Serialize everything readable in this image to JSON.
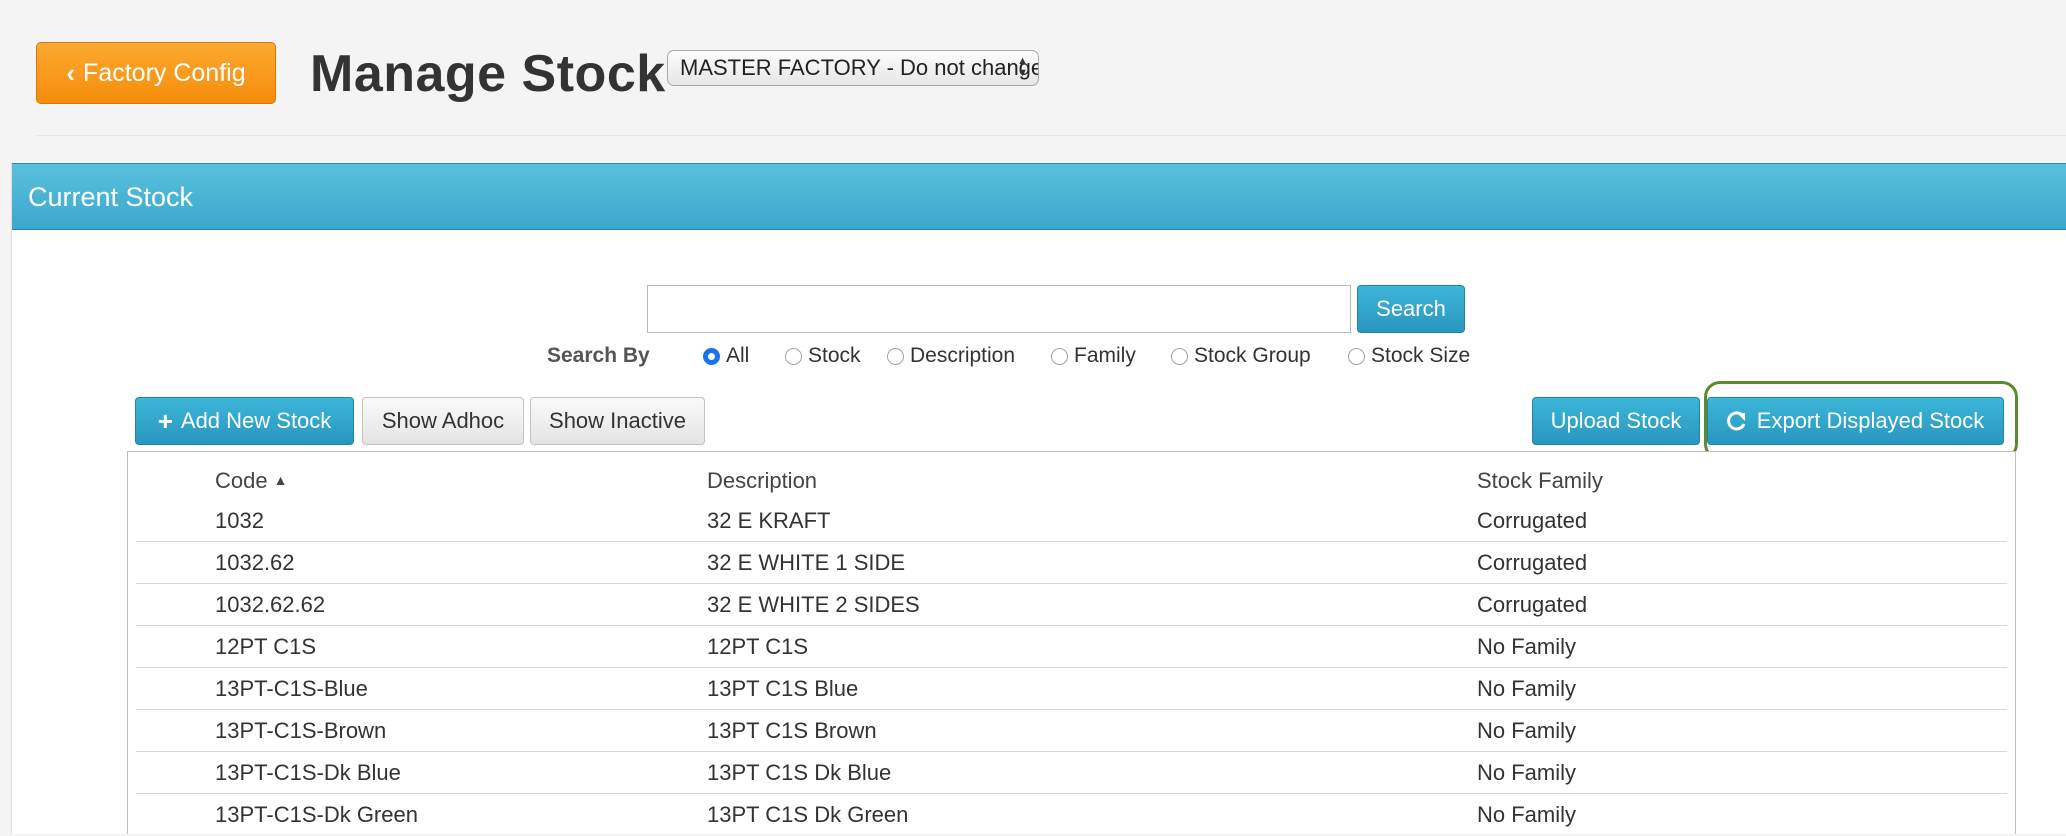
{
  "header": {
    "back_button_label": "Factory Config",
    "title": "Manage Stock",
    "factory_select_value": "MASTER FACTORY - Do not change"
  },
  "panel": {
    "title": "Current Stock"
  },
  "search": {
    "input_value": "",
    "button_label": "Search",
    "search_by_label": "Search By",
    "options": [
      "All",
      "Stock",
      "Description",
      "Family",
      "Stock Group",
      "Stock Size"
    ],
    "selected": "All"
  },
  "toolbar": {
    "add_new_label": "Add New Stock",
    "show_adhoc_label": "Show Adhoc",
    "show_inactive_label": "Show Inactive",
    "upload_label": "Upload Stock",
    "export_label": "Export Displayed Stock"
  },
  "table": {
    "columns": [
      "Code",
      "Description",
      "Stock Family"
    ],
    "sorted_by": "Code",
    "rows": [
      [
        "1032",
        "32 E KRAFT",
        "Corrugated"
      ],
      [
        "1032.62",
        "32 E WHITE 1 SIDE",
        "Corrugated"
      ],
      [
        "1032.62.62",
        "32 E WHITE 2 SIDES",
        "Corrugated"
      ],
      [
        "12PT C1S",
        "12PT C1S",
        "No Family"
      ],
      [
        "13PT-C1S-Blue",
        "13PT C1S Blue",
        "No Family"
      ],
      [
        "13PT-C1S-Brown",
        "13PT C1S Brown",
        "No Family"
      ],
      [
        "13PT-C1S-Dk Blue",
        "13PT C1S Dk Blue",
        "No Family"
      ],
      [
        "13PT-C1S-Dk Green",
        "13PT C1S Dk Green",
        "No Family"
      ]
    ]
  },
  "colors": {
    "orange_button": "#f79a1c",
    "header_blue": "#4cb6d9",
    "button_blue": "#2f9fc6",
    "highlight_green": "#5c8a2e"
  }
}
